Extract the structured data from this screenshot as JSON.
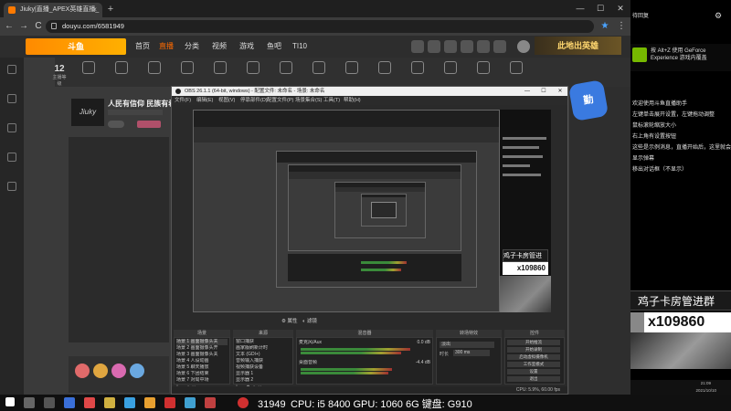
{
  "browser": {
    "tab_title": "Jiuky|直播_APEX英雄直播_斗鱼",
    "new_tab": "+",
    "controls": {
      "min": "—",
      "max": "☐",
      "close": "✕"
    },
    "url": "douyu.com/6581949",
    "nav": {
      "back": "←",
      "forward": "→",
      "reload": "C"
    }
  },
  "site": {
    "logo": "斗鱼",
    "nav": [
      {
        "label": "首页"
      },
      {
        "label": "直播",
        "active": true
      },
      {
        "label": "分类"
      },
      {
        "label": "视频"
      },
      {
        "label": "游戏"
      },
      {
        "label": "鱼吧"
      },
      {
        "label": "TI10"
      }
    ],
    "follow_count": "12",
    "follow_label": "主播等级",
    "room_title": "人民有信仰 民族有希",
    "streamer": "Jiuky",
    "brand_banner": "此地出英雄",
    "mascot": "勤"
  },
  "obs": {
    "title": "OBS 26.1.1 (64-bit, windows) - 配置文件: 未命名 - 场景: 未命名",
    "menu": [
      "文件(F)",
      "编辑(E)",
      "视图(V)",
      "停靠部件(D)",
      "配置文件(P)",
      "场景集合(S)",
      "工具(T)",
      "帮助(H)"
    ],
    "preview_overlay": {
      "banner": "鸡子卡房管进群",
      "viewers": "x109860"
    },
    "mid_toolbar": [
      "属性",
      "滤镜"
    ],
    "docks": {
      "scenes": {
        "header": "场景",
        "items": [
          "场景 1 画面摄像头关",
          "场景 2 画面摄像头开",
          "场景 3 画面摄像头关",
          "场景 4 人设动画",
          "场景 5 聊天播放",
          "场景 6 下团结束",
          "场景 7 对局中场"
        ]
      },
      "sources": {
        "header": "来源",
        "items": [
          "窗口捕获",
          "画家版刷新计时",
          "文本 (GDI+)",
          "音频输入捕获",
          "视频捕获设备",
          "显示器 1",
          "显示器 2"
        ]
      },
      "mixer": {
        "header": "混音器",
        "items": [
          {
            "name": "麦克风/Aux",
            "db": "0.0 dB"
          },
          {
            "name": "桌面音频",
            "db": "-4.4 dB"
          }
        ]
      },
      "transitions": {
        "header": "转场特效",
        "fade": "淡出",
        "duration_label": "时长",
        "duration": "300 ms"
      },
      "controls": {
        "header": "控件",
        "buttons": [
          "开始推流",
          "开始录制",
          "启动虚拟摄像机",
          "工作室模式",
          "设置",
          "退出"
        ]
      }
    },
    "status": "CPU: 5.9%, 60.00 fps"
  },
  "right_panel": {
    "top_text": "待回复",
    "nv_title": "按 Alt+Z 使用 GeForce Experience 游戏内覆盖",
    "lines": [
      "欢迎使用斗鱼直播助手",
      "左键单击展开设置，左键拖动调整",
      "鼠标滚轮缩放大小",
      "右上角有设置按钮",
      "这些是示例消息，直播开始后，这里就会",
      "显示弹幕",
      "移出对话框（不显示）"
    ],
    "banner": "鸡子卡房管进群",
    "viewers": "x109860",
    "clock": "21:09",
    "date": "2021/10/10"
  },
  "taskbar": {
    "count": "31949",
    "hardware": "CPU: i5 8400 GPU: 1060 6G 键盘: G910"
  },
  "colors": {
    "douyu_orange": "#ff6a00",
    "nvidia_green": "#76b900"
  }
}
